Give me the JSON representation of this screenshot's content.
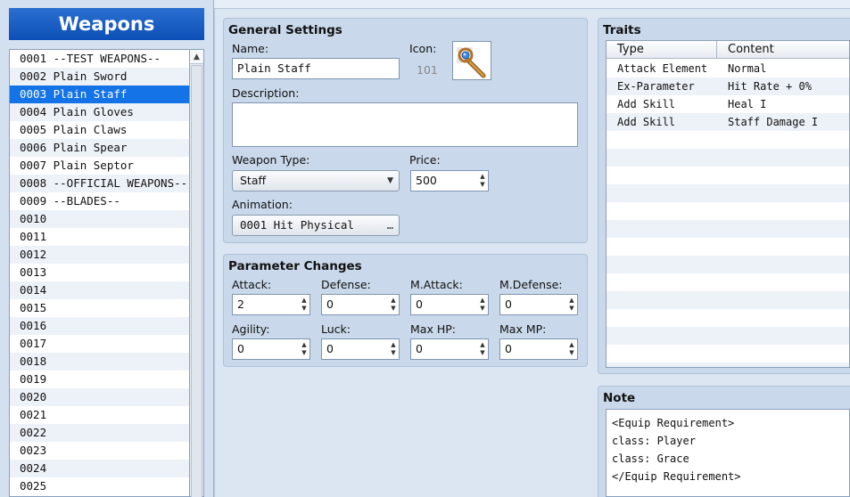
{
  "weapons_title": "Weapons",
  "weapon_list": [
    {
      "text": "0001 --TEST WEAPONS--"
    },
    {
      "text": "0002 Plain Sword"
    },
    {
      "text": "0003 Plain Staff",
      "selected": true
    },
    {
      "text": "0004 Plain Gloves"
    },
    {
      "text": "0005 Plain Claws"
    },
    {
      "text": "0006 Plain Spear"
    },
    {
      "text": "0007 Plain Septor"
    },
    {
      "text": "0008 --OFFICIAL WEAPONS--"
    },
    {
      "text": "0009 --BLADES--"
    },
    {
      "text": "0010"
    },
    {
      "text": "0011"
    },
    {
      "text": "0012"
    },
    {
      "text": "0013"
    },
    {
      "text": "0014"
    },
    {
      "text": "0015"
    },
    {
      "text": "0016"
    },
    {
      "text": "0017"
    },
    {
      "text": "0018"
    },
    {
      "text": "0019"
    },
    {
      "text": "0020"
    },
    {
      "text": "0021"
    },
    {
      "text": "0022"
    },
    {
      "text": "0023"
    },
    {
      "text": "0024"
    },
    {
      "text": "0025"
    }
  ],
  "general": {
    "title": "General Settings",
    "name_label": "Name:",
    "name_value": "Plain Staff",
    "icon_label": "Icon:",
    "icon_index": "101",
    "description_label": "Description:",
    "description_value": "",
    "weapon_type_label": "Weapon Type:",
    "weapon_type_value": "Staff",
    "price_label": "Price:",
    "price_value": "500",
    "animation_label": "Animation:",
    "animation_value": "0001 Hit Physical",
    "animation_button": "…"
  },
  "params": {
    "title": "Parameter Changes",
    "fields": [
      {
        "label": "Attack:",
        "value": "2"
      },
      {
        "label": "Defense:",
        "value": "0"
      },
      {
        "label": "M.Attack:",
        "value": "0"
      },
      {
        "label": "M.Defense:",
        "value": "0"
      },
      {
        "label": "Agility:",
        "value": "0"
      },
      {
        "label": "Luck:",
        "value": "0"
      },
      {
        "label": "Max HP:",
        "value": "0"
      },
      {
        "label": "Max MP:",
        "value": "0"
      }
    ]
  },
  "traits": {
    "title": "Traits",
    "col_type": "Type",
    "col_content": "Content",
    "rows": [
      {
        "type": "Attack Element",
        "content": "Normal"
      },
      {
        "type": "Ex-Parameter",
        "content": "Hit Rate + 0%"
      },
      {
        "type": "Add Skill",
        "content": "Heal I"
      },
      {
        "type": "Add Skill",
        "content": "Staff Damage I"
      }
    ]
  },
  "note": {
    "title": "Note",
    "lines": [
      "<Equip Requirement>",
      "class: Player",
      "class: Grace",
      "</Equip Requirement>"
    ]
  }
}
